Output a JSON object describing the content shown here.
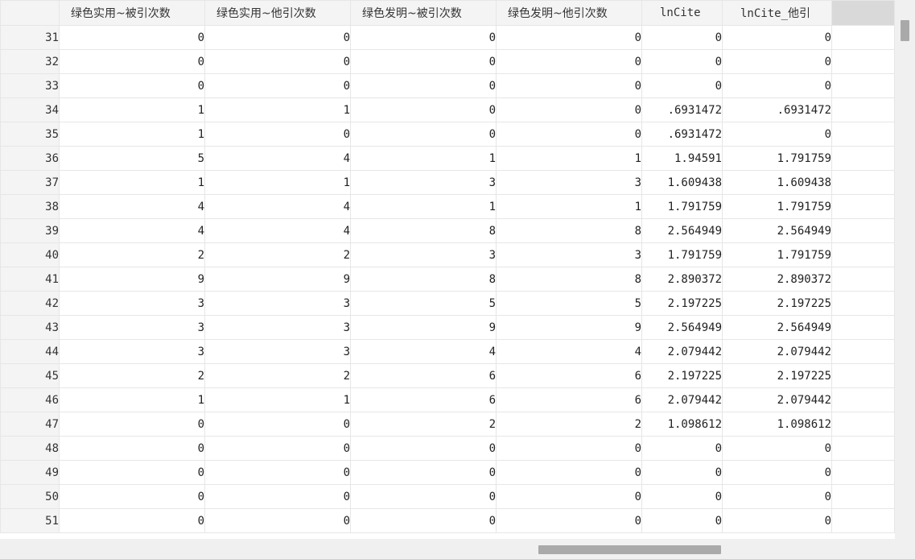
{
  "columns": [
    {
      "label": "绿色实用~被引次数"
    },
    {
      "label": "绿色实用~他引次数"
    },
    {
      "label": "绿色发明~被引次数"
    },
    {
      "label": "绿色发明~他引次数"
    },
    {
      "label": "lnCite"
    },
    {
      "label": "lnCite_他引"
    }
  ],
  "rows": [
    {
      "n": "31",
      "cells": [
        "0",
        "0",
        "0",
        "0",
        "0",
        "0"
      ]
    },
    {
      "n": "32",
      "cells": [
        "0",
        "0",
        "0",
        "0",
        "0",
        "0"
      ]
    },
    {
      "n": "33",
      "cells": [
        "0",
        "0",
        "0",
        "0",
        "0",
        "0"
      ]
    },
    {
      "n": "34",
      "cells": [
        "1",
        "1",
        "0",
        "0",
        ".6931472",
        ".6931472"
      ]
    },
    {
      "n": "35",
      "cells": [
        "1",
        "0",
        "0",
        "0",
        ".6931472",
        "0"
      ]
    },
    {
      "n": "36",
      "cells": [
        "5",
        "4",
        "1",
        "1",
        "1.94591",
        "1.791759"
      ]
    },
    {
      "n": "37",
      "cells": [
        "1",
        "1",
        "3",
        "3",
        "1.609438",
        "1.609438"
      ]
    },
    {
      "n": "38",
      "cells": [
        "4",
        "4",
        "1",
        "1",
        "1.791759",
        "1.791759"
      ]
    },
    {
      "n": "39",
      "cells": [
        "4",
        "4",
        "8",
        "8",
        "2.564949",
        "2.564949"
      ]
    },
    {
      "n": "40",
      "cells": [
        "2",
        "2",
        "3",
        "3",
        "1.791759",
        "1.791759"
      ]
    },
    {
      "n": "41",
      "cells": [
        "9",
        "9",
        "8",
        "8",
        "2.890372",
        "2.890372"
      ]
    },
    {
      "n": "42",
      "cells": [
        "3",
        "3",
        "5",
        "5",
        "2.197225",
        "2.197225"
      ]
    },
    {
      "n": "43",
      "cells": [
        "3",
        "3",
        "9",
        "9",
        "2.564949",
        "2.564949"
      ]
    },
    {
      "n": "44",
      "cells": [
        "3",
        "3",
        "4",
        "4",
        "2.079442",
        "2.079442"
      ]
    },
    {
      "n": "45",
      "cells": [
        "2",
        "2",
        "6",
        "6",
        "2.197225",
        "2.197225"
      ]
    },
    {
      "n": "46",
      "cells": [
        "1",
        "1",
        "6",
        "6",
        "2.079442",
        "2.079442"
      ]
    },
    {
      "n": "47",
      "cells": [
        "0",
        "0",
        "2",
        "2",
        "1.098612",
        "1.098612"
      ]
    },
    {
      "n": "48",
      "cells": [
        "0",
        "0",
        "0",
        "0",
        "0",
        "0"
      ]
    },
    {
      "n": "49",
      "cells": [
        "0",
        "0",
        "0",
        "0",
        "0",
        "0"
      ]
    },
    {
      "n": "50",
      "cells": [
        "0",
        "0",
        "0",
        "0",
        "0",
        "0"
      ]
    },
    {
      "n": "51",
      "cells": [
        "0",
        "0",
        "0",
        "0",
        "0",
        "0"
      ]
    }
  ]
}
